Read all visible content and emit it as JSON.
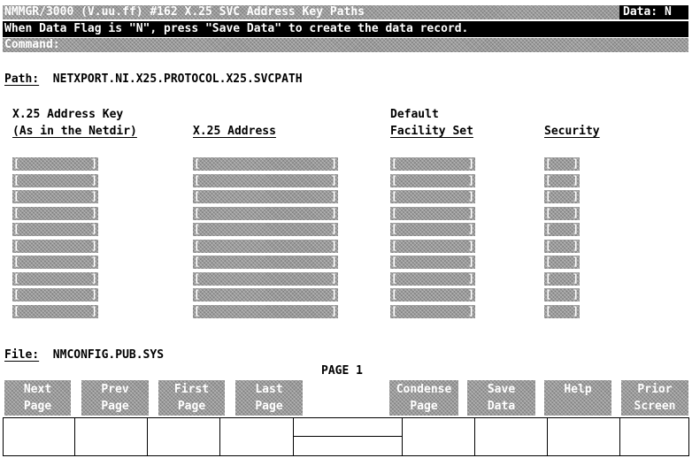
{
  "header": {
    "title": "NMMGR/3000 (V.uu.ff) #162 X.25 SVC Address Key Paths",
    "data_flag": "Data: N",
    "message": "When Data Flag is \"N\", press \"Save Data\" to create the data record.",
    "command_label": "Command:"
  },
  "path": {
    "label": "Path:",
    "value": "NETXPORT.NI.X25.PROTOCOL.X25.SVCPATH"
  },
  "columns": {
    "address_key_line1": "X.25 Address Key",
    "address_key_line2": "(As in the Netdir)",
    "address": "X.25 Address",
    "facility_line1": "Default",
    "facility_line2": "Facility Set",
    "security": "Security"
  },
  "file": {
    "label": "File:",
    "value": "NMCONFIG.PUB.SYS"
  },
  "page_indicator": "PAGE 1",
  "function_keys": [
    {
      "line1": "Next",
      "line2": "Page"
    },
    {
      "line1": "Prev",
      "line2": "Page"
    },
    {
      "line1": "First",
      "line2": "Page"
    },
    {
      "line1": "Last",
      "line2": "Page"
    },
    {
      "line1": "Condense",
      "line2": "Page"
    },
    {
      "line1": "Save",
      "line2": "Data"
    },
    {
      "line1": "Help",
      "line2": ""
    },
    {
      "line1": "Prior",
      "line2": "Screen"
    }
  ],
  "field_brackets": {
    "open": "[",
    "close": "]"
  }
}
